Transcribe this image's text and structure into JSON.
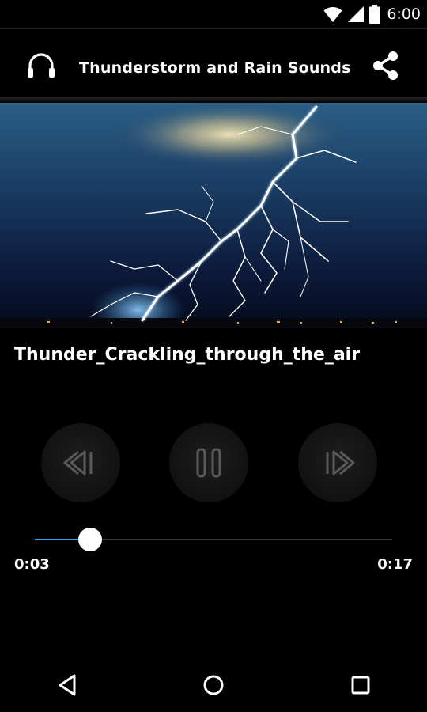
{
  "status_bar": {
    "time": "6:00",
    "icons": [
      "wifi-icon",
      "signal-icon",
      "battery-icon"
    ]
  },
  "app_bar": {
    "title": "Thunderstorm and Rain Sounds",
    "left_icon": "headphones-icon",
    "right_icon": "share-icon"
  },
  "track": {
    "title": "Thunder_Crackling_through_the_air"
  },
  "controls": {
    "previous_icon": "skip-previous-icon",
    "play_state_icon": "pause-icon",
    "next_icon": "skip-next-icon"
  },
  "progress": {
    "elapsed": "0:03",
    "total": "0:17",
    "fraction": 0.155
  },
  "colors": {
    "accent": "#2fa3e0",
    "background": "#000000"
  },
  "nav_bar": {
    "icons": [
      "back-icon",
      "home-icon",
      "recent-apps-icon"
    ]
  }
}
